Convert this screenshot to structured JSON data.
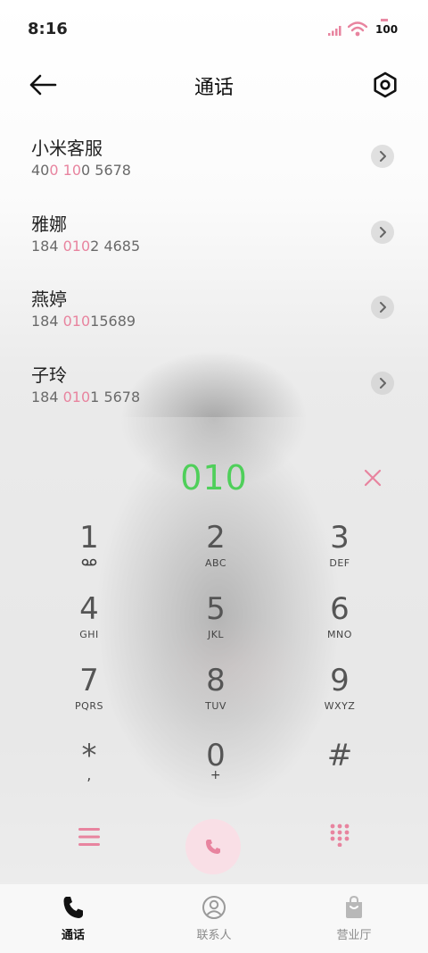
{
  "status_bar": {
    "time": "8:16",
    "battery": "100",
    "icons": [
      "signal-icon",
      "wifi-icon",
      "battery-icon"
    ]
  },
  "header": {
    "title": "通话",
    "back_icon": "arrow-left-icon",
    "settings_icon": "hexagon-settings-icon"
  },
  "contacts": [
    {
      "name": "小米客服",
      "number_parts": [
        "40",
        "0",
        " ",
        "10",
        "0 5678"
      ]
    },
    {
      "name": "雅娜",
      "number_parts": [
        "184 ",
        "010",
        "2 4685"
      ]
    },
    {
      "name": "燕婷",
      "number_parts": [
        "184 ",
        "010",
        "15689"
      ]
    },
    {
      "name": "子玲",
      "number_parts": [
        "184 ",
        "010",
        "1 5678"
      ]
    }
  ],
  "dialer": {
    "entered_number": "010",
    "keys": [
      {
        "digit": "1",
        "letters": ""
      },
      {
        "digit": "2",
        "letters": "ABC"
      },
      {
        "digit": "3",
        "letters": "DEF"
      },
      {
        "digit": "4",
        "letters": "GHI"
      },
      {
        "digit": "5",
        "letters": "JKL"
      },
      {
        "digit": "6",
        "letters": "MNO"
      },
      {
        "digit": "7",
        "letters": "PQRS"
      },
      {
        "digit": "8",
        "letters": "TUV"
      },
      {
        "digit": "9",
        "letters": "WXYZ"
      },
      {
        "digit": "*",
        "letters": ","
      },
      {
        "digit": "0",
        "letters": "+"
      },
      {
        "digit": "#",
        "letters": ""
      }
    ]
  },
  "tabs": [
    {
      "label": "通话",
      "icon": "phone-icon",
      "active": true
    },
    {
      "label": "联系人",
      "icon": "person-icon",
      "active": false
    },
    {
      "label": "营业厅",
      "icon": "shopping-bag-icon",
      "active": false
    }
  ],
  "colors": {
    "accent_pink": "#e8849f",
    "entered_green": "#4fcf5a"
  }
}
